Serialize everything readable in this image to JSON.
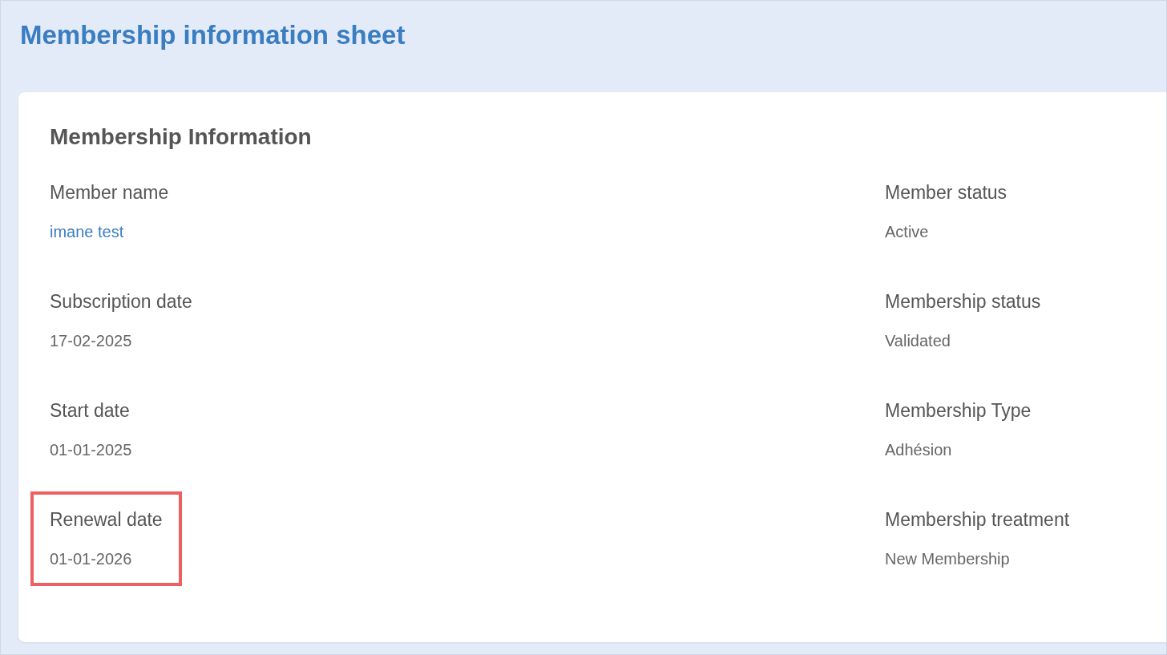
{
  "page": {
    "title": "Membership information sheet"
  },
  "card": {
    "title": "Membership Information",
    "fields": [
      {
        "label": "Member name",
        "value": "imane test",
        "kind": "link",
        "highlighted": false
      },
      {
        "label": "Member status",
        "value": "Active",
        "kind": "text",
        "highlighted": false
      },
      {
        "label": "Subscription date",
        "value": "17-02-2025",
        "kind": "text",
        "highlighted": false
      },
      {
        "label": "Membership status",
        "value": "Validated",
        "kind": "text",
        "highlighted": false
      },
      {
        "label": "Start date",
        "value": "01-01-2025",
        "kind": "text",
        "highlighted": false
      },
      {
        "label": "Membership Type",
        "value": "Adhésion",
        "kind": "text",
        "highlighted": false
      },
      {
        "label": "Renewal date",
        "value": "01-01-2026",
        "kind": "text",
        "highlighted": true
      },
      {
        "label": "Membership treatment",
        "value": "New Membership",
        "kind": "text",
        "highlighted": false
      }
    ]
  }
}
